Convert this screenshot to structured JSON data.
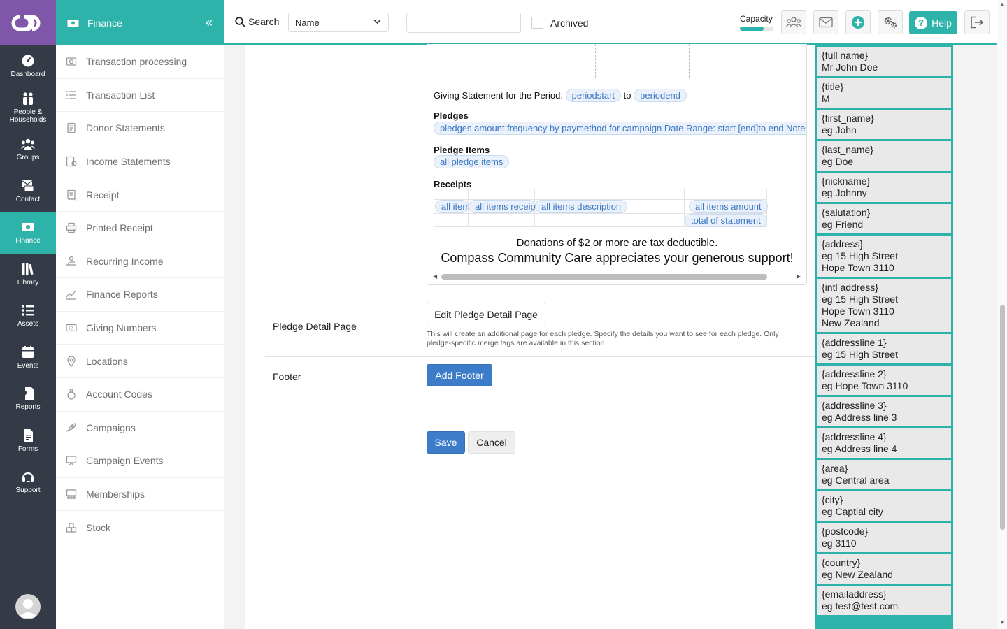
{
  "rail": {
    "items": [
      {
        "label": "Dashboard",
        "icon": "dashboard-icon"
      },
      {
        "label": "People & Households",
        "icon": "people-icon"
      },
      {
        "label": "Groups",
        "icon": "groups-icon"
      },
      {
        "label": "Contact",
        "icon": "contact-icon"
      },
      {
        "label": "Finance",
        "icon": "finance-icon",
        "active": true
      },
      {
        "label": "Library",
        "icon": "library-icon"
      },
      {
        "label": "Assets",
        "icon": "assets-icon"
      },
      {
        "label": "Events",
        "icon": "events-icon"
      },
      {
        "label": "Reports",
        "icon": "reports-icon"
      },
      {
        "label": "Forms",
        "icon": "forms-icon"
      },
      {
        "label": "Support",
        "icon": "support-icon"
      }
    ]
  },
  "submenu": {
    "title": "Finance",
    "items": [
      {
        "label": "Transaction processing",
        "icon": "transaction-processing-icon"
      },
      {
        "label": "Transaction List",
        "icon": "list-icon"
      },
      {
        "label": "Donor Statements",
        "icon": "document-icon"
      },
      {
        "label": "Income Statements",
        "icon": "income-statement-icon"
      },
      {
        "label": "Receipt",
        "icon": "receipt-icon"
      },
      {
        "label": "Printed Receipt",
        "icon": "printer-icon"
      },
      {
        "label": "Recurring Income",
        "icon": "recurring-income-icon"
      },
      {
        "label": "Finance Reports",
        "icon": "finance-reports-icon"
      },
      {
        "label": "Giving Numbers",
        "icon": "giving-numbers-icon"
      },
      {
        "label": "Locations",
        "icon": "location-pin-icon"
      },
      {
        "label": "Account Codes",
        "icon": "account-codes-icon"
      },
      {
        "label": "Campaigns",
        "icon": "rocket-icon"
      },
      {
        "label": "Campaign Events",
        "icon": "campaign-events-icon"
      },
      {
        "label": "Memberships",
        "icon": "memberships-icon"
      },
      {
        "label": "Stock",
        "icon": "stock-icon"
      }
    ]
  },
  "topbar": {
    "search_label": "Search",
    "select_value": "Name",
    "archived_label": "Archived",
    "capacity_label": "Capacity",
    "capacity_fraction": 0.7,
    "help_label": "Help"
  },
  "preview": {
    "period_label": "Giving Statement for the Period:",
    "period_start": "periodstart",
    "period_to": "to",
    "period_end": "periodend",
    "pledges_heading": "Pledges",
    "pledges_tag": "pledges amount frequency by paymethod for campaign Date Range: start [end]to end Note:",
    "pledge_items_heading": "Pledge Items",
    "pledge_items_tag": "all pledge items",
    "receipts_heading": "Receipts",
    "receipt_tags": [
      "all items",
      "all items receipt",
      "all items description",
      "all items amount",
      "total of statement"
    ],
    "tax_line": "Donations of $2 or more are tax deductible.",
    "thanks_line": "Compass Community Care appreciates your generous support!"
  },
  "pledge_detail": {
    "label": "Pledge Detail Page",
    "button": "Edit Pledge Detail Page",
    "hint": "This will create an additional page for each pledge. Specify the details you want to see for each pledge. Only pledge-specific merge tags are available in this section."
  },
  "footer_row": {
    "label": "Footer",
    "button": "Add Footer"
  },
  "actions": {
    "save": "Save",
    "cancel": "Cancel"
  },
  "merge_tags": [
    {
      "tag": "{full name}",
      "example": "Mr John Doe"
    },
    {
      "tag": "{title}",
      "example": "M"
    },
    {
      "tag": "{first_name}",
      "example": "eg John"
    },
    {
      "tag": "{last_name}",
      "example": "eg Doe"
    },
    {
      "tag": "{nickname}",
      "example": "eg Johnny"
    },
    {
      "tag": "{salutation}",
      "example": "eg Friend"
    },
    {
      "tag": "{address}",
      "example": "eg 15 High Street\nHope Town 3110"
    },
    {
      "tag": "{intl address}",
      "example": "eg 15 High Street\nHope Town 3110\nNew Zealand"
    },
    {
      "tag": "{addressline 1}",
      "example": "eg 15 High Street"
    },
    {
      "tag": "{addressline 2}",
      "example": "eg Hope Town 3110"
    },
    {
      "tag": "{addressline 3}",
      "example": "eg Address line 3"
    },
    {
      "tag": "{addressline 4}",
      "example": "eg Address line 4"
    },
    {
      "tag": "{area}",
      "example": "eg Central area"
    },
    {
      "tag": "{city}",
      "example": "eg Captial city"
    },
    {
      "tag": "{postcode}",
      "example": "eg 3110"
    },
    {
      "tag": "{country}",
      "example": "eg New Zealand"
    },
    {
      "tag": "{emailaddress}",
      "example": "eg test@test.com"
    }
  ],
  "colors": {
    "accent": "#2eb3aa",
    "rail": "#343a46",
    "logo": "#7f56a8",
    "primary_button": "#3c7cc8"
  }
}
